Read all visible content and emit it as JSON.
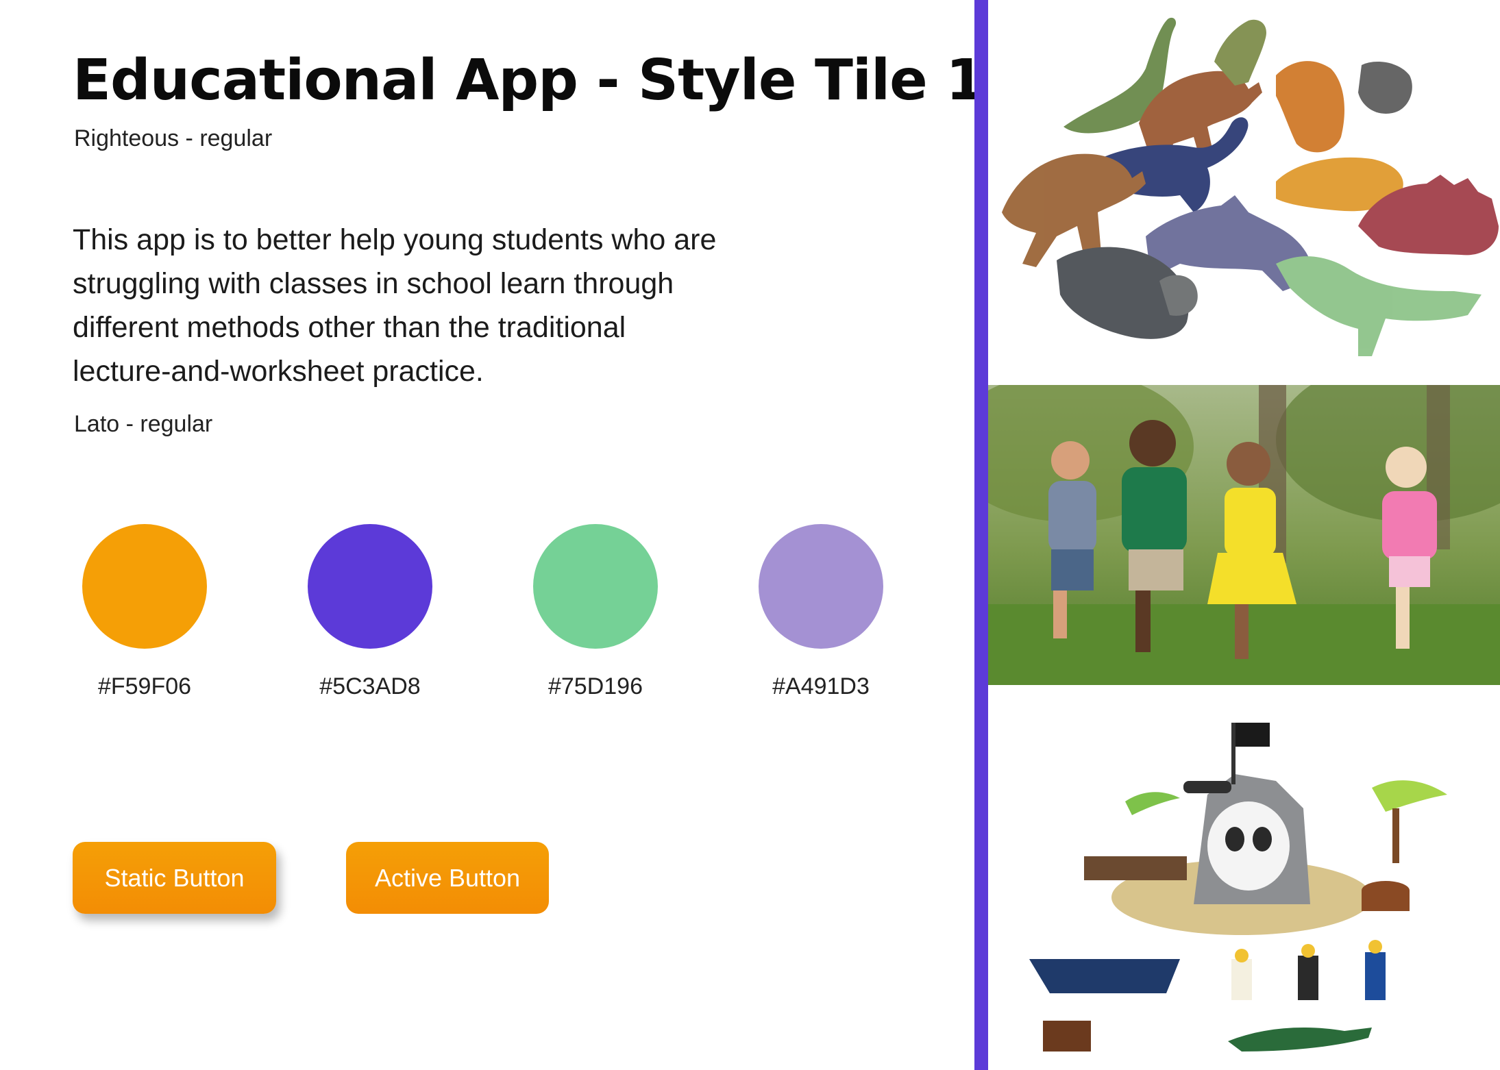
{
  "title": "Educational App - Style Tile 1",
  "title_font_label": "Righteous - regular",
  "body_text": "This app is to better help young students who are struggling with classes in school learn through different methods other than the traditional lecture-and-worksheet practice.",
  "body_font_label": "Lato - regular",
  "palette": [
    {
      "hex": "#F59F06",
      "color": "#F59F06"
    },
    {
      "hex": "#5C3AD8",
      "color": "#5C3AD8"
    },
    {
      "hex": "#75D196",
      "color": "#75D196"
    },
    {
      "hex": "#A491D3",
      "color": "#A491D3"
    }
  ],
  "buttons": {
    "static_label": "Static Button",
    "active_label": "Active Button"
  },
  "accent_colors": {
    "divider": "#5C3AD8",
    "button": "#F59F06"
  },
  "images": [
    "toy-dinosaurs-photo",
    "children-running-photo",
    "pirate-lego-set-photo"
  ]
}
